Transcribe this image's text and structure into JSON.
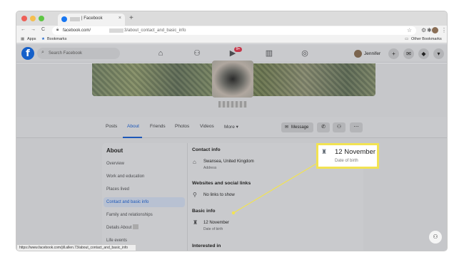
{
  "browser": {
    "tab_title": "| Facebook",
    "tab_close": "×",
    "new_tab": "+",
    "url_prefix": "facebook.com/",
    "url_suffix": "3/about_contact_and_basic_info",
    "nav_back": "←",
    "nav_forward": "→",
    "nav_reload": "C",
    "bookmarks": {
      "apps_label": "Apps",
      "bookmarks_label": "Bookmarks",
      "other_label": "Other Bookmarks"
    },
    "status_url": "https://www.facebook.com/jill.allen.73/about_contact_and_basic_info"
  },
  "fb": {
    "logo": "f",
    "search_placeholder": "Search Facebook",
    "notification_badge": "9+",
    "user_name": "Jennifer",
    "tabs": [
      "Posts",
      "About",
      "Friends",
      "Photos",
      "Videos",
      "More ▾"
    ],
    "active_tab": "About",
    "message_label": "Message"
  },
  "about": {
    "title": "About",
    "sidebar": [
      "Overview",
      "Work and education",
      "Places lived",
      "Contact and basic info",
      "Family and relationships",
      "Details About",
      "Life events"
    ],
    "active_item": "Contact and basic info",
    "contact_header": "Contact info",
    "address_value": "Swansea, United Kingdom",
    "address_label": "Address",
    "websites_header": "Websites and social links",
    "no_links": "No links to show",
    "basic_header": "Basic info",
    "birth_value": "12 November",
    "birth_label": "Date of birth",
    "interested_header": "Interested in"
  },
  "callout": {
    "value": "12 November",
    "label": "Date of birth",
    "accent": "#f2e352"
  },
  "colors": {
    "fb_blue": "#1877f2",
    "active_blue": "#1c57b8"
  }
}
